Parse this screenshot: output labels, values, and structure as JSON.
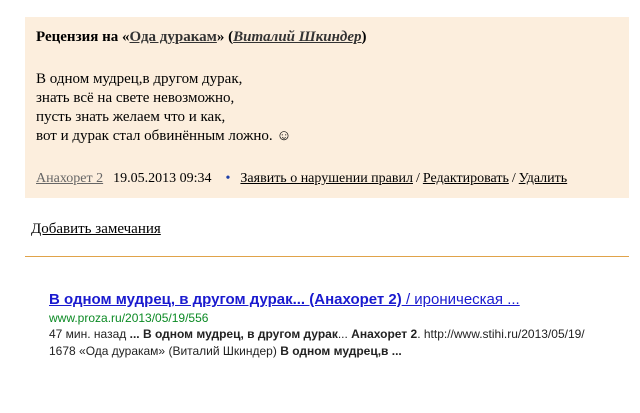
{
  "review": {
    "title_prefix": "Рецензия на «",
    "work_title": "Ода дуракам",
    "title_mid": "» (",
    "author": "Виталий Шкиндер",
    "title_suffix": ")",
    "lines": [
      "В одном мудрец,в другом дурак,",
      "знать всё на свете невозможно,",
      "пусть знать желаем что и как,",
      "вот и дурак стал обвинённым ложно. ☺"
    ],
    "reviewer": "Анахорет 2",
    "date": "19.05.2013 09:34",
    "bullet": "•",
    "report_label": "Заявить о нарушении правил",
    "edit_label": "Редактировать",
    "delete_label": "Удалить",
    "separator": "/"
  },
  "add_note_label": "Добавить замечания",
  "search_result": {
    "title_main": "В одном мудрец, в другом дурак... (Анахорет 2)",
    "title_rest": " / ироническая ...",
    "url": "www.proza.ru/2013/05/19/556",
    "snippet_time": "47 мин. назад",
    "snippet_bold1": "... В одном мудрец, в другом дурак",
    "snippet_text1": "... ",
    "snippet_bold2": "Анахорет 2",
    "snippet_text2": ". http://www.stihi.ru/2013/05/19/ 1678 «Ода дуракам» (Виталий Шкиндер) ",
    "snippet_bold3": "В одном мудрец,в ..."
  },
  "colors": {
    "review_bg": "#fceedd",
    "divider": "#e0a34a",
    "result_title": "#1a1acf",
    "result_url": "#0b8a24"
  }
}
